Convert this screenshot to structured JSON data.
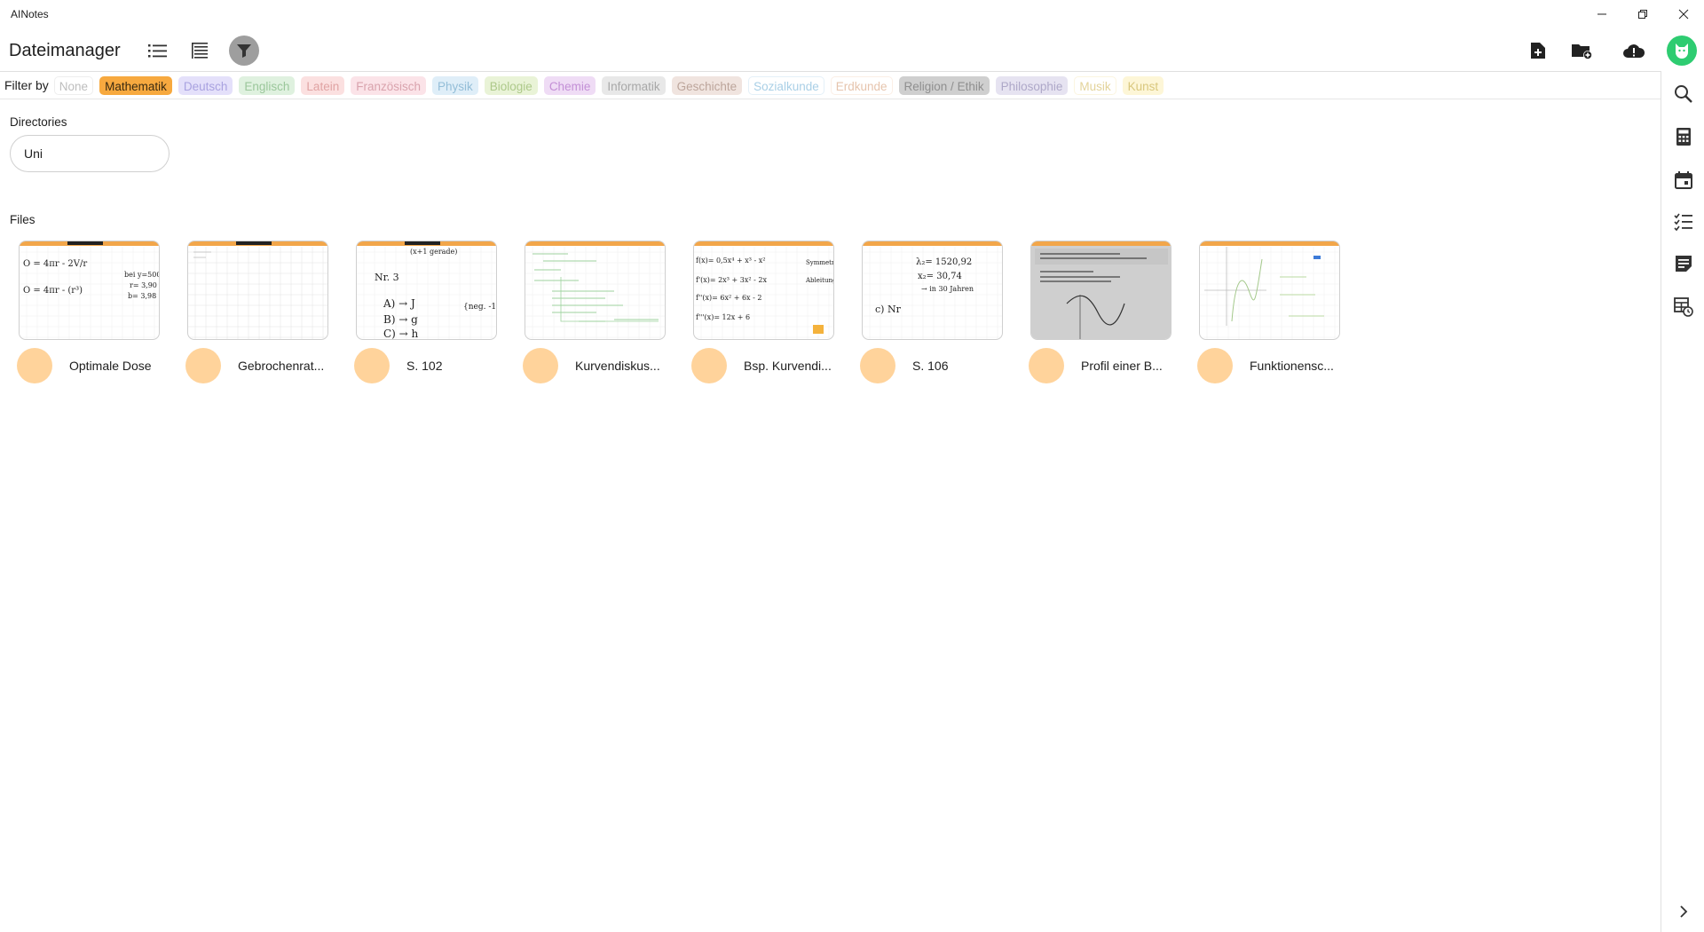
{
  "app": {
    "title": "AINotes"
  },
  "header": {
    "title": "Dateimanager"
  },
  "filter": {
    "label": "Filter by",
    "chips": [
      {
        "label": "None",
        "bg": "#ffffff",
        "fg": "#bdbdbd",
        "border": "#eeeeee"
      },
      {
        "label": "Mathematik",
        "bg": "#f7a93f",
        "fg": "#3a2a10",
        "border": "#f7a93f"
      },
      {
        "label": "Deutsch",
        "bg": "#e4e0fa",
        "fg": "#a9a2e0",
        "border": "#e4e0fa"
      },
      {
        "label": "Englisch",
        "bg": "#dff1df",
        "fg": "#9bc79b",
        "border": "#dff1df"
      },
      {
        "label": "Latein",
        "bg": "#fbe0e0",
        "fg": "#e0a3a3",
        "border": "#fbe0e0"
      },
      {
        "label": "Französisch",
        "bg": "#fbe3e8",
        "fg": "#d9a3ad",
        "border": "#fbe3e8"
      },
      {
        "label": "Physik",
        "bg": "#dfeef8",
        "fg": "#94bed8",
        "border": "#dfeef8"
      },
      {
        "label": "Biologie",
        "bg": "#e9f3d7",
        "fg": "#adc98a",
        "border": "#e9f3d7"
      },
      {
        "label": "Chemie",
        "bg": "#efdcf5",
        "fg": "#c38fd6",
        "border": "#efdcf5"
      },
      {
        "label": "Informatik",
        "bg": "#e8e8e8",
        "fg": "#a8a8a8",
        "border": "#e8e8e8"
      },
      {
        "label": "Geschichte",
        "bg": "#f0e4df",
        "fg": "#bca59b",
        "border": "#f0e4df"
      },
      {
        "label": "Sozialkunde",
        "bg": "#ffffff",
        "fg": "#a9cfe6",
        "border": "#e4f0f8"
      },
      {
        "label": "Erdkunde",
        "bg": "#ffffff",
        "fg": "#e6c4ad",
        "border": "#fbefe6"
      },
      {
        "label": "Religion / Ethik",
        "bg": "#cfcfcf",
        "fg": "#8f8f8f",
        "border": "#cfcfcf"
      },
      {
        "label": "Philosophie",
        "bg": "#e6e3f1",
        "fg": "#aea8c8",
        "border": "#e6e3f1"
      },
      {
        "label": "Musik",
        "bg": "#ffffff",
        "fg": "#e3d39a",
        "border": "#fbf5e0"
      },
      {
        "label": "Kunst",
        "bg": "#fdf6d7",
        "fg": "#d9c77d",
        "border": "#fdf6d7"
      }
    ]
  },
  "directories": {
    "label": "Directories",
    "items": [
      {
        "name": "Uni"
      }
    ]
  },
  "files": {
    "label": "Files",
    "items": [
      {
        "name": "Optimale Dose",
        "thumb": "formula"
      },
      {
        "name": "Gebrochenrat...",
        "thumb": "grid"
      },
      {
        "name": "S. 102",
        "thumb": "handwriting"
      },
      {
        "name": "Kurvendiskus...",
        "thumb": "green"
      },
      {
        "name": "Bsp. Kurvendi...",
        "thumb": "formula2"
      },
      {
        "name": "S. 106",
        "thumb": "handwriting2"
      },
      {
        "name": "Profil einer B...",
        "thumb": "photo"
      },
      {
        "name": "Funktionensc...",
        "thumb": "graph"
      }
    ]
  },
  "colors": {
    "accent": "#f7a93f",
    "tag": "#ffd39b",
    "avatar": "#2ecc71"
  },
  "icons": {
    "header": [
      "list-view-icon",
      "sort-icon",
      "filter-icon",
      "new-file-icon",
      "new-folder-icon",
      "cloud-sync-icon",
      "avatar-icon"
    ],
    "rail": [
      "search-icon",
      "calculator-icon",
      "calendar-icon",
      "checklist-icon",
      "notes-icon",
      "table-icon",
      "chevron-right-icon"
    ]
  }
}
